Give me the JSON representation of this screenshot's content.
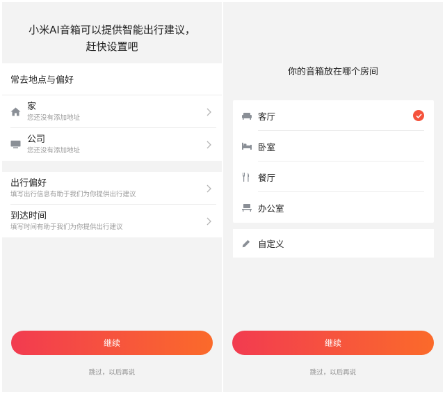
{
  "left": {
    "headline_line1": "小米AI音箱可以提供智能出行建议，",
    "headline_line2": "赶快设置吧",
    "places_title": "常去地点与偏好",
    "places": [
      {
        "icon": "home-icon",
        "title": "家",
        "sub": "您还没有添加地址"
      },
      {
        "icon": "monitor-icon",
        "title": "公司",
        "sub": "您还没有添加地址"
      }
    ],
    "prefs": [
      {
        "title": "出行偏好",
        "sub": "填写出行信息有助于我们为你提供出行建议"
      },
      {
        "title": "到达时间",
        "sub": "填写时间有助于我们为你提供出行建议"
      }
    ],
    "continue_label": "继续",
    "skip_label": "跳过，以后再说"
  },
  "right": {
    "question": "你的音箱放在哪个房间",
    "rooms": [
      {
        "icon": "sofa-icon",
        "label": "客厅",
        "selected": true
      },
      {
        "icon": "bed-icon",
        "label": "卧室",
        "selected": false
      },
      {
        "icon": "fork-knife-icon",
        "label": "餐厅",
        "selected": false
      },
      {
        "icon": "desk-icon",
        "label": "办公室",
        "selected": false
      }
    ],
    "custom": {
      "icon": "pencil-icon",
      "label": "自定义"
    },
    "continue_label": "继续",
    "skip_label": "跳过，以后再说"
  },
  "colors": {
    "accent_start": "#f23b50",
    "accent_end": "#fb6a2a",
    "check": "#f5533c",
    "background": "#f3f3f3"
  }
}
